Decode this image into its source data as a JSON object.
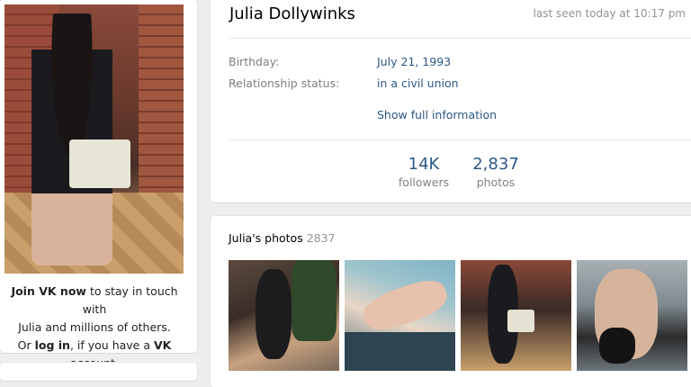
{
  "profile": {
    "name": "Julia Dollywinks",
    "last_seen": "last seen today at 10:17 pm",
    "info": [
      {
        "label": "Birthday:",
        "value": "July 21, 1993"
      },
      {
        "label": "Relationship status:",
        "value": "in a civil union"
      }
    ],
    "show_full": "Show full information",
    "counters": [
      {
        "value": "14K",
        "label": "followers"
      },
      {
        "value": "2,837",
        "label": "photos"
      }
    ]
  },
  "join": {
    "line1_bold": "Join VK now",
    "line1_rest": " to stay in touch with",
    "line2": "Julia and millions of others.",
    "line3_pre": "Or ",
    "line3_login": "log in",
    "line3_mid": ", if you have a ",
    "line3_vk": "VK",
    "line3_post": " account."
  },
  "photos": {
    "title": "Julia's photos",
    "count": "2837"
  },
  "colors": {
    "link": "#2a5885",
    "muted": "#7c7f82",
    "background": "#edeef0"
  }
}
